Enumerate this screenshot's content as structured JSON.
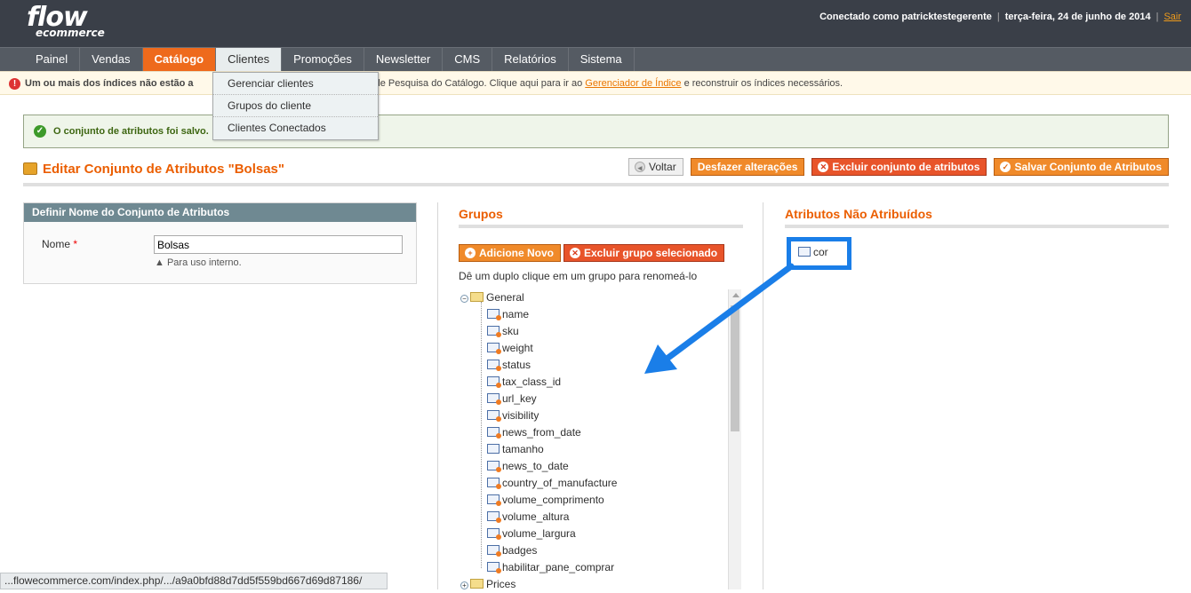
{
  "header": {
    "logo_top": "flow",
    "logo_bottom": "ecommerce",
    "user_text": "Conectado como patricktestegerente",
    "date_text": "terça-feira, 24 de junho de 2014",
    "logout": "Sair"
  },
  "nav": [
    "Painel",
    "Vendas",
    "Catálogo",
    "Clientes",
    "Promoções",
    "Newsletter",
    "CMS",
    "Relatórios",
    "Sistema"
  ],
  "dropdown": [
    "Gerenciar clientes",
    "Grupos do cliente",
    "Clientes Conectados"
  ],
  "notice": {
    "bold": "Um ou mais dos índices não estão a",
    "text": "ice de Pesquisa do Catálogo. Clique aqui para ir ao ",
    "link": "Gerenciador de Índice",
    "text2": " e reconstruir os índices necessários."
  },
  "success": "O conjunto de atributos foi salvo.",
  "page_title": "Editar Conjunto de Atributos \"Bolsas\"",
  "buttons": {
    "back": "Voltar",
    "reset": "Desfazer alterações",
    "delete": "Excluir conjunto de atributos",
    "save": "Salvar Conjunto de Atributos"
  },
  "name_panel": {
    "title": "Definir Nome do Conjunto de Atributos",
    "label": "Nome",
    "required": "*",
    "value": "Bolsas",
    "note": "Para uso interno."
  },
  "groups": {
    "title": "Grupos",
    "add": "Adicione Novo",
    "delete": "Excluir grupo selecionado",
    "hint": "Dê um duplo clique em um grupo para renomeá-lo",
    "group1": "General",
    "items": [
      "name",
      "sku",
      "weight",
      "status",
      "tax_class_id",
      "url_key",
      "visibility",
      "news_from_date",
      "tamanho",
      "news_to_date",
      "country_of_manufacture",
      "volume_comprimento",
      "volume_altura",
      "volume_largura",
      "badges",
      "habilitar_pane_comprar"
    ],
    "group2": "Prices"
  },
  "unassigned": {
    "title": "Atributos Não Atribuídos",
    "items": [
      "cor"
    ]
  },
  "statusbar": "...flowecommerce.com/index.php/.../a9a0bfd88d7dd5f559bd667d69d87186/",
  "colors": {
    "accent": "#eb5e00",
    "highlight": "#1a7ee8"
  }
}
